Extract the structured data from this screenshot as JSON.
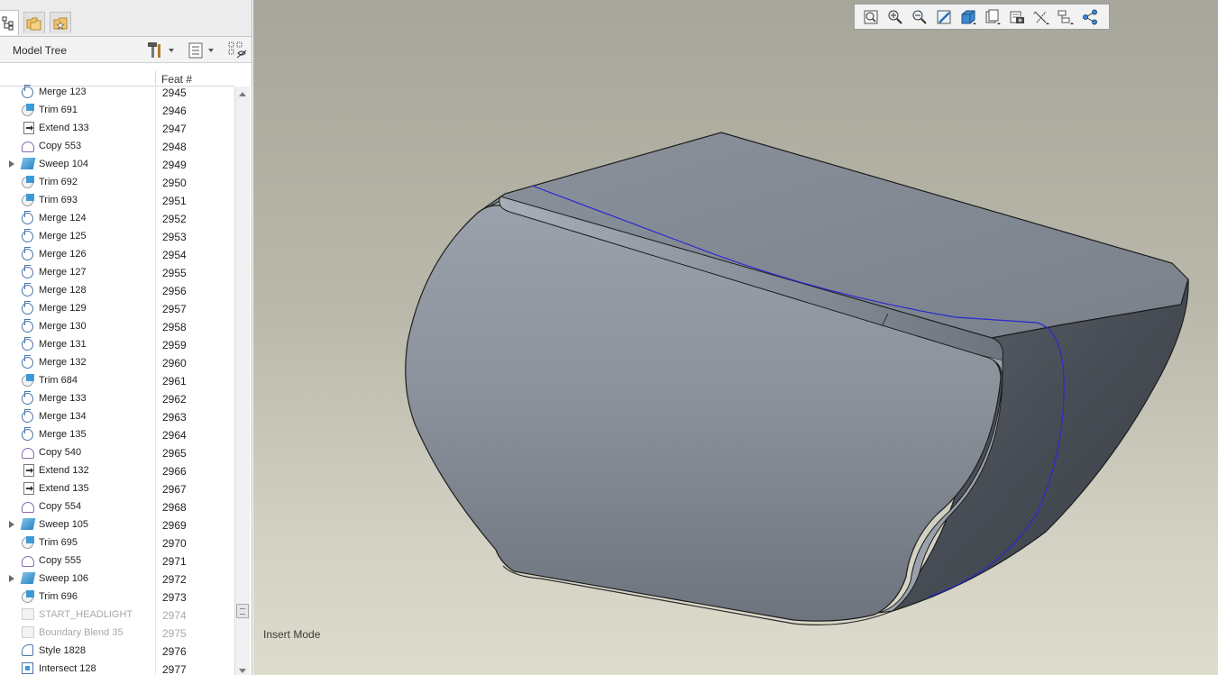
{
  "panel": {
    "title": "Model Tree",
    "column_header": "Feat #"
  },
  "tree_rows": [
    {
      "name": "Merge 123",
      "num": "2945",
      "icon": "merge-icon"
    },
    {
      "name": "Trim 691",
      "num": "2946",
      "icon": "trim-icon"
    },
    {
      "name": "Extend 133",
      "num": "2947",
      "icon": "extend-icon"
    },
    {
      "name": "Copy 553",
      "num": "2948",
      "icon": "copy-icon"
    },
    {
      "name": "Sweep 104",
      "num": "2949",
      "icon": "sweep-icon",
      "expandable": true
    },
    {
      "name": "Trim 692",
      "num": "2950",
      "icon": "trim-icon"
    },
    {
      "name": "Trim 693",
      "num": "2951",
      "icon": "trim-icon"
    },
    {
      "name": "Merge 124",
      "num": "2952",
      "icon": "merge-icon"
    },
    {
      "name": "Merge 125",
      "num": "2953",
      "icon": "merge-icon"
    },
    {
      "name": "Merge 126",
      "num": "2954",
      "icon": "merge-icon"
    },
    {
      "name": "Merge 127",
      "num": "2955",
      "icon": "merge-icon"
    },
    {
      "name": "Merge 128",
      "num": "2956",
      "icon": "merge-icon"
    },
    {
      "name": "Merge 129",
      "num": "2957",
      "icon": "merge-icon"
    },
    {
      "name": "Merge 130",
      "num": "2958",
      "icon": "merge-icon"
    },
    {
      "name": "Merge 131",
      "num": "2959",
      "icon": "merge-icon"
    },
    {
      "name": "Merge 132",
      "num": "2960",
      "icon": "merge-icon"
    },
    {
      "name": "Trim 684",
      "num": "2961",
      "icon": "trim-icon"
    },
    {
      "name": "Merge 133",
      "num": "2962",
      "icon": "merge-icon"
    },
    {
      "name": "Merge 134",
      "num": "2963",
      "icon": "merge-icon"
    },
    {
      "name": "Merge 135",
      "num": "2964",
      "icon": "merge-icon"
    },
    {
      "name": "Copy 540",
      "num": "2965",
      "icon": "copy-icon"
    },
    {
      "name": "Extend 132",
      "num": "2966",
      "icon": "extend-icon"
    },
    {
      "name": "Extend 135",
      "num": "2967",
      "icon": "extend-icon"
    },
    {
      "name": "Copy 554",
      "num": "2968",
      "icon": "copy-icon"
    },
    {
      "name": "Sweep 105",
      "num": "2969",
      "icon": "sweep-icon",
      "expandable": true
    },
    {
      "name": "Trim 695",
      "num": "2970",
      "icon": "trim-icon"
    },
    {
      "name": "Copy 555",
      "num": "2971",
      "icon": "copy-icon"
    },
    {
      "name": "Sweep 106",
      "num": "2972",
      "icon": "sweep-icon",
      "expandable": true
    },
    {
      "name": "Trim 696",
      "num": "2973",
      "icon": "trim-icon"
    },
    {
      "name": "START_HEADLIGHT",
      "num": "2974",
      "icon": "layer-icon",
      "dimmed": true
    },
    {
      "name": "Boundary Blend 35",
      "num": "2975",
      "icon": "boundary-blend-icon",
      "dimmed": true
    },
    {
      "name": "Style 1828",
      "num": "2976",
      "icon": "style-icon"
    },
    {
      "name": "Intersect 128",
      "num": "2977",
      "icon": "intersect-icon"
    }
  ],
  "viewport": {
    "status_text": "Insert Mode"
  },
  "view_toolbar": [
    "refit-icon",
    "zoom-in-icon",
    "zoom-out-icon",
    "repaint-icon",
    "display-style-icon",
    "saved-orientations-icon",
    "view-manager-icon",
    "datum-display-icon",
    "spin-center-icon",
    "annotation-display-icon"
  ],
  "colors": {
    "viewport_top": "#a7a69a",
    "viewport_bottom": "#dedccd",
    "model_surface": "#8b929c",
    "highlight_curve": "#2a2ad0"
  }
}
